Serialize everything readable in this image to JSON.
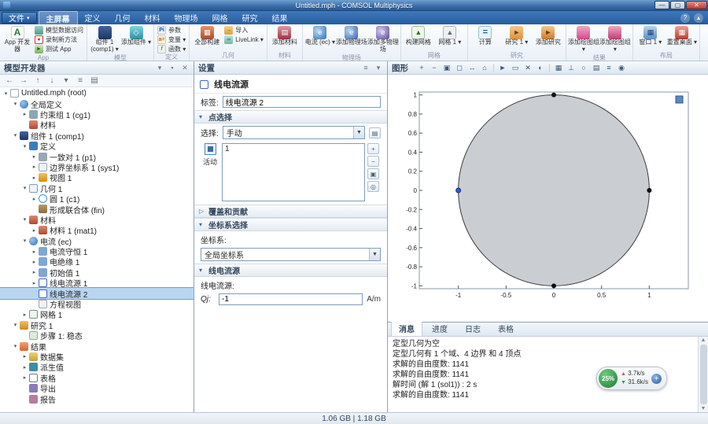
{
  "window": {
    "title": "Untitled.mph - COMSOL Multiphysics",
    "status_memory": "1.06 GB | 1.18 GB"
  },
  "menubar": {
    "file_tab": "文件",
    "tabs": [
      "主屏幕",
      "定义",
      "几何",
      "材料",
      "物理场",
      "网格",
      "研究",
      "结果"
    ],
    "active_tab": "主屏幕"
  },
  "ribbon": {
    "groups": [
      {
        "label": "App",
        "buttons": [
          {
            "label": "App 开发器",
            "type": "large",
            "icon": "app-builder",
            "glyph": "A"
          },
          {
            "label": "模型数据访问",
            "type": "small",
            "icon": "data-access"
          },
          {
            "label": "录制新方法",
            "type": "small",
            "icon": "record-method",
            "glyph": "●"
          },
          {
            "label": "测试 App",
            "type": "small",
            "icon": "test-app",
            "glyph": "►"
          }
        ]
      },
      {
        "label": "模型",
        "buttons": [
          {
            "label": "组件 1 (comp1)",
            "type": "large",
            "icon": "component",
            "dropdown": true
          },
          {
            "label": "添加组件",
            "type": "large",
            "icon": "add-component",
            "dropdown": true,
            "glyph": "◇"
          }
        ]
      },
      {
        "label": "定义",
        "buttons": [
          {
            "label": "参数",
            "type": "small",
            "icon": "parameters",
            "glyph": "Pi"
          },
          {
            "label": "变量",
            "type": "small",
            "icon": "variables",
            "dropdown": true,
            "glyph": "a="
          },
          {
            "label": "函数",
            "type": "small",
            "icon": "functions",
            "dropdown": true,
            "glyph": "f"
          }
        ]
      },
      {
        "label": "几何",
        "buttons": [
          {
            "label": "全部构建",
            "type": "large",
            "icon": "build-all",
            "glyph": "▦"
          },
          {
            "label": "导入",
            "type": "small",
            "icon": "import",
            "glyph": "→"
          },
          {
            "label": "LiveLink",
            "type": "small",
            "icon": "livelink",
            "dropdown": true,
            "glyph": "∞"
          }
        ]
      },
      {
        "label": "材料",
        "buttons": [
          {
            "label": "添加材料",
            "type": "large",
            "icon": "add-material",
            "glyph": "▤"
          }
        ]
      },
      {
        "label": "物理场",
        "buttons": [
          {
            "label": "电流 (ec)",
            "type": "large",
            "icon": "physics-ec",
            "dropdown": true,
            "glyph": "e"
          },
          {
            "label": "添加物理场",
            "type": "large",
            "icon": "add-physics",
            "glyph": "e"
          },
          {
            "label": "添加多物理场",
            "type": "large",
            "icon": "add-multiphysics",
            "glyph": "e"
          }
        ]
      },
      {
        "label": "网格",
        "buttons": [
          {
            "label": "构建网格",
            "type": "large",
            "icon": "build-mesh",
            "glyph": "▲"
          },
          {
            "label": "网格 1",
            "type": "large",
            "icon": "mesh",
            "dropdown": true,
            "glyph": "▲"
          }
        ]
      },
      {
        "label": "研究",
        "buttons": [
          {
            "label": "计算",
            "type": "large",
            "icon": "compute",
            "glyph": "="
          },
          {
            "label": "研究 1",
            "type": "large",
            "icon": "study",
            "dropdown": true,
            "glyph": "►"
          },
          {
            "label": "添加研究",
            "type": "large",
            "icon": "add-study",
            "glyph": "►"
          }
        ]
      },
      {
        "label": "结果",
        "buttons": [
          {
            "label": "添加绘图组",
            "type": "large",
            "icon": "plot-group",
            "dropdown": true
          },
          {
            "label": "添加绘图组",
            "type": "large",
            "icon": "add-plot-group",
            "dropdown": true
          }
        ]
      },
      {
        "label": "布局",
        "buttons": [
          {
            "label": "窗口 1",
            "type": "large",
            "icon": "windows",
            "dropdown": true,
            "glyph": "▦"
          },
          {
            "label": "重置桌面",
            "type": "large",
            "icon": "reset-desktop",
            "dropdown": true,
            "glyph": "▦"
          }
        ]
      }
    ]
  },
  "model_builder": {
    "title": "模型开发器",
    "items": [
      {
        "label": "Untitled.mph (root)",
        "depth": 0,
        "icon": "root",
        "expand": "open"
      },
      {
        "label": "全局定义",
        "depth": 1,
        "icon": "global",
        "expand": "open"
      },
      {
        "label": "约束组 1 (cg1)",
        "depth": 2,
        "icon": "cg",
        "expand": "closed"
      },
      {
        "label": "材料",
        "depth": 2,
        "icon": "material",
        "expand": "leaf"
      },
      {
        "label": "组件 1 (comp1)",
        "depth": 1,
        "icon": "component",
        "expand": "open"
      },
      {
        "label": "定义",
        "depth": 2,
        "icon": "definitions",
        "expand": "open"
      },
      {
        "label": "一致对 1 (p1)",
        "depth": 3,
        "icon": "pair",
        "expand": "closed"
      },
      {
        "label": "边界坐标系 1 (sys1)",
        "depth": 3,
        "icon": "sys",
        "expand": "closed"
      },
      {
        "label": "视图 1",
        "depth": 3,
        "icon": "view",
        "expand": "closed"
      },
      {
        "label": "几何 1",
        "depth": 2,
        "icon": "geometry",
        "expand": "open"
      },
      {
        "label": "圆 1 (c1)",
        "depth": 3,
        "icon": "circle",
        "expand": "closed"
      },
      {
        "label": "形成联合体 (fin)",
        "depth": 3,
        "icon": "union",
        "expand": "leaf"
      },
      {
        "label": "材料",
        "depth": 2,
        "icon": "material",
        "expand": "open"
      },
      {
        "label": "材料 1 (mat1)",
        "depth": 3,
        "icon": "material",
        "expand": "closed"
      },
      {
        "label": "电流 (ec)",
        "depth": 2,
        "icon": "physics",
        "expand": "open"
      },
      {
        "label": "电流守恒 1",
        "depth": 3,
        "icon": "feature",
        "expand": "closed"
      },
      {
        "label": "电绝缘 1",
        "depth": 3,
        "icon": "feature",
        "expand": "closed"
      },
      {
        "label": "初始值 1",
        "depth": 3,
        "icon": "feature",
        "expand": "closed"
      },
      {
        "label": "线电流源 1",
        "depth": 3,
        "icon": "point",
        "expand": "closed"
      },
      {
        "label": "线电流源 2",
        "depth": 3,
        "icon": "point",
        "expand": "leaf",
        "selected": true
      },
      {
        "label": "方程视图",
        "depth": 3,
        "icon": "equation",
        "expand": "leaf"
      },
      {
        "label": "网格 1",
        "depth": 2,
        "icon": "mesh",
        "expand": "closed"
      },
      {
        "label": "研究 1",
        "depth": 1,
        "icon": "study",
        "expand": "open"
      },
      {
        "label": "步骤 1: 稳态",
        "depth": 2,
        "icon": "step",
        "expand": "leaf"
      },
      {
        "label": "结果",
        "depth": 1,
        "icon": "results",
        "expand": "open"
      },
      {
        "label": "数据集",
        "depth": 2,
        "icon": "dataset",
        "expand": "closed"
      },
      {
        "label": "派生值",
        "depth": 2,
        "icon": "derived",
        "expand": "closed"
      },
      {
        "label": "表格",
        "depth": 2,
        "icon": "table",
        "expand": "closed"
      },
      {
        "label": "导出",
        "depth": 2,
        "icon": "export",
        "expand": "leaf"
      },
      {
        "label": "报告",
        "depth": 2,
        "icon": "report",
        "expand": "leaf"
      }
    ]
  },
  "settings": {
    "title": "设置",
    "feature": "线电流源",
    "label_caption": "标签:",
    "label_value": "线电流源 2",
    "point_selection_section": "点选择",
    "selection_caption": "选择:",
    "selection_value": "手动",
    "active_label": "活动",
    "selection_items": [
      "1"
    ],
    "override_section": "覆盖和贡献",
    "coord_section": "坐标系选择",
    "coord_caption": "坐标系:",
    "coord_value": "全局坐标系",
    "source_section": "线电流源",
    "source_caption": "线电流源:",
    "qj_label": "Qj:",
    "qj_value": "-1",
    "qj_unit": "A/m"
  },
  "graphics": {
    "title": "图形",
    "toolbar": [
      "zoom-in",
      "zoom-out",
      "zoom-extents",
      "zoom-box",
      "pan",
      "go-to-default-view",
      "select",
      "box-select",
      "deselect",
      "transparency",
      "grid",
      "axes",
      "scene-light",
      "image-snapshot",
      "print",
      "camera"
    ],
    "plot": {
      "x_ticks": [
        -1,
        -0.5,
        0,
        0.5,
        1
      ],
      "y_ticks": [
        1,
        0.8,
        0.6,
        0.4,
        0.2,
        0,
        -0.2,
        -0.4,
        -0.6,
        -0.8,
        -1
      ],
      "circle": {
        "cx": 0,
        "cy": 0,
        "r": 1
      },
      "points": [
        {
          "x": 0,
          "y": 1
        },
        {
          "x": 1,
          "y": 0
        },
        {
          "x": 0,
          "y": -1
        },
        {
          "x": -1,
          "y": 0,
          "selected": true
        }
      ]
    }
  },
  "messages": {
    "tabs": [
      "消息",
      "进度",
      "日志",
      "表格"
    ],
    "active_tab": "消息",
    "lines": [
      "定型几何为空",
      "定型几何有 1 个域、4 边界 和 4 顶点",
      "求解的自由度数: 1141",
      "求解的自由度数: 1141",
      "解时间 (解 1 (sol1)) : 2 s",
      "求解的自由度数: 1141"
    ]
  },
  "overlay": {
    "cpu": "25%",
    "up": "3.7k/s",
    "down": "31.6k/s"
  }
}
